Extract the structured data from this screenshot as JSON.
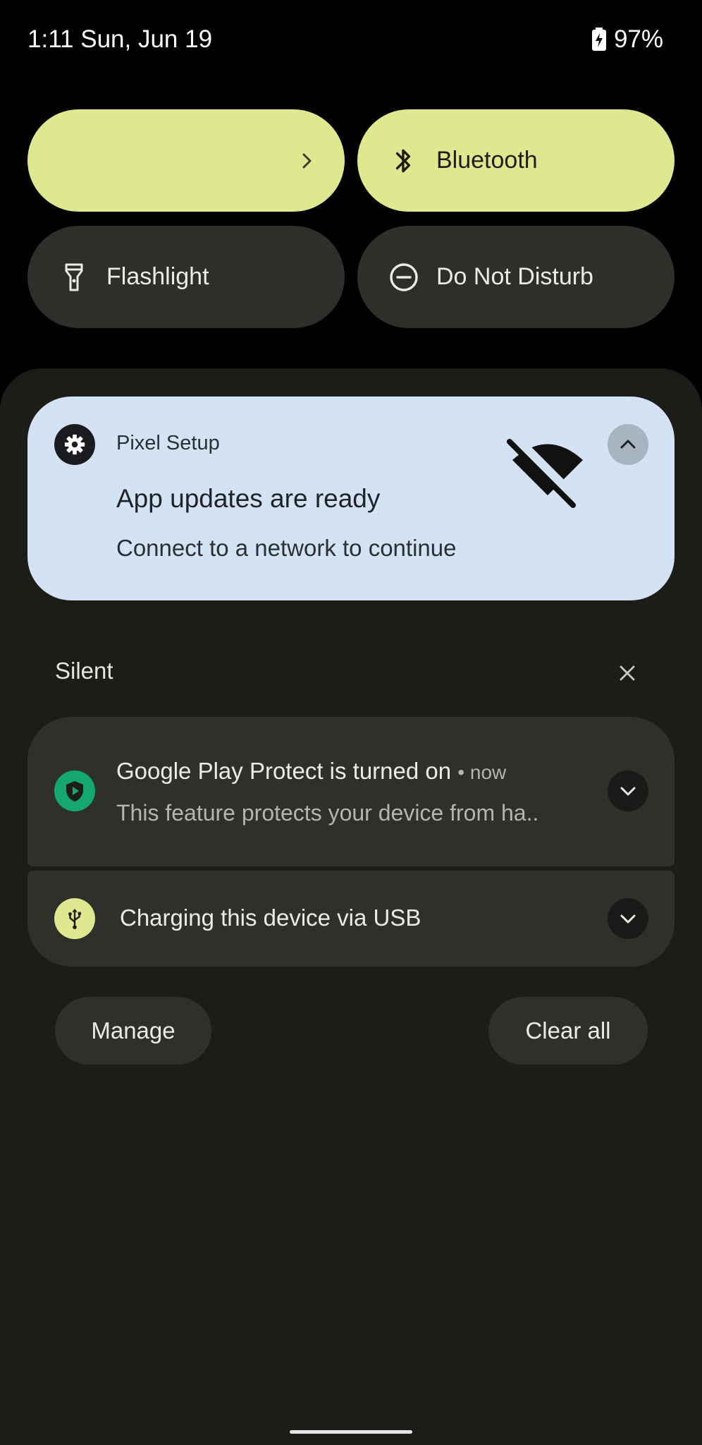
{
  "status_bar": {
    "time_date": "1:11 Sun, Jun 19",
    "battery_icon": "battery-charging-icon",
    "battery_percent": "97%"
  },
  "quick_settings": {
    "tiles": [
      {
        "label": "",
        "state": "on",
        "icon": "chevron-right-icon"
      },
      {
        "label": "Bluetooth",
        "state": "on",
        "icon": "bluetooth-icon"
      },
      {
        "label": "Flashlight",
        "state": "off",
        "icon": "flashlight-icon"
      },
      {
        "label": "Do Not Disturb",
        "state": "off",
        "icon": "do-not-disturb-icon"
      }
    ],
    "on_color": "#dfe88f",
    "off_color": "#2e2e2b"
  },
  "hero_notification": {
    "app_name": "Pixel Setup",
    "title": "App updates are ready",
    "text": "Connect to a network to continue",
    "app_icon": "gear-icon",
    "image_icon": "wifi-off-icon",
    "collapse_icon": "chevron-up-icon",
    "background": "#d3e3f3"
  },
  "silent_section": {
    "label": "Silent",
    "close_icon": "close-icon",
    "notifications": [
      {
        "title": "Google Play Protect is turned on",
        "time": "now",
        "text": "This feature protects your device from ha..",
        "icon": "play-protect-icon",
        "icon_color": "#14a86e"
      },
      {
        "title": "Charging this device via USB",
        "icon": "usb-icon",
        "icon_color": "#dfe88f"
      }
    ]
  },
  "actions": {
    "manage_label": "Manage",
    "clear_all_label": "Clear all"
  }
}
